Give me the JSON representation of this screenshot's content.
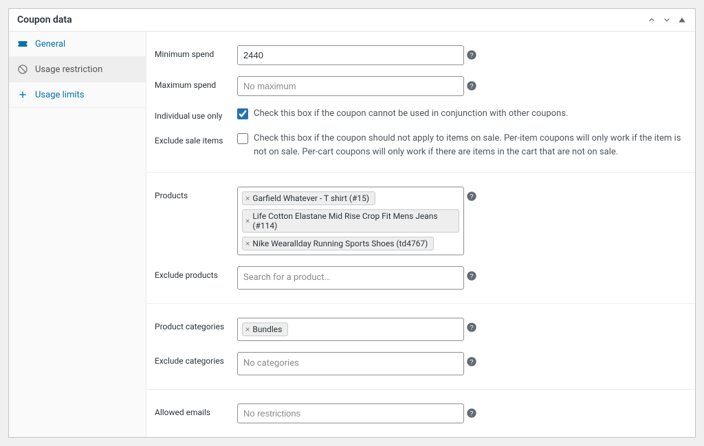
{
  "panel": {
    "title": "Coupon data"
  },
  "sidebar": {
    "items": [
      {
        "label": "General"
      },
      {
        "label": "Usage restriction"
      },
      {
        "label": "Usage limits"
      }
    ]
  },
  "fields": {
    "min_spend": {
      "label": "Minimum spend",
      "value": "2440"
    },
    "max_spend": {
      "label": "Maximum spend",
      "placeholder": "No maximum"
    },
    "individual": {
      "label": "Individual use only",
      "desc": "Check this box if the coupon cannot be used in conjunction with other coupons."
    },
    "exclude_sale": {
      "label": "Exclude sale items",
      "desc": "Check this box if the coupon should not apply to items on sale. Per-item coupons will only work if the item is not on sale. Per-cart coupons will only work if there are items in the cart that are not on sale."
    },
    "products": {
      "label": "Products",
      "tags": [
        "Garfield Whatever - T shirt (#15)",
        "Life Cotton Elastane Mid Rise Crop Fit Mens Jeans (#114)",
        "Nike Wearallday Running Sports Shoes (td4767)"
      ]
    },
    "exclude_products": {
      "label": "Exclude products",
      "placeholder": "Search for a product…"
    },
    "product_categories": {
      "label": "Product categories",
      "tags": [
        "Bundles"
      ]
    },
    "exclude_categories": {
      "label": "Exclude categories",
      "placeholder": "No categories"
    },
    "allowed_emails": {
      "label": "Allowed emails",
      "placeholder": "No restrictions"
    }
  }
}
